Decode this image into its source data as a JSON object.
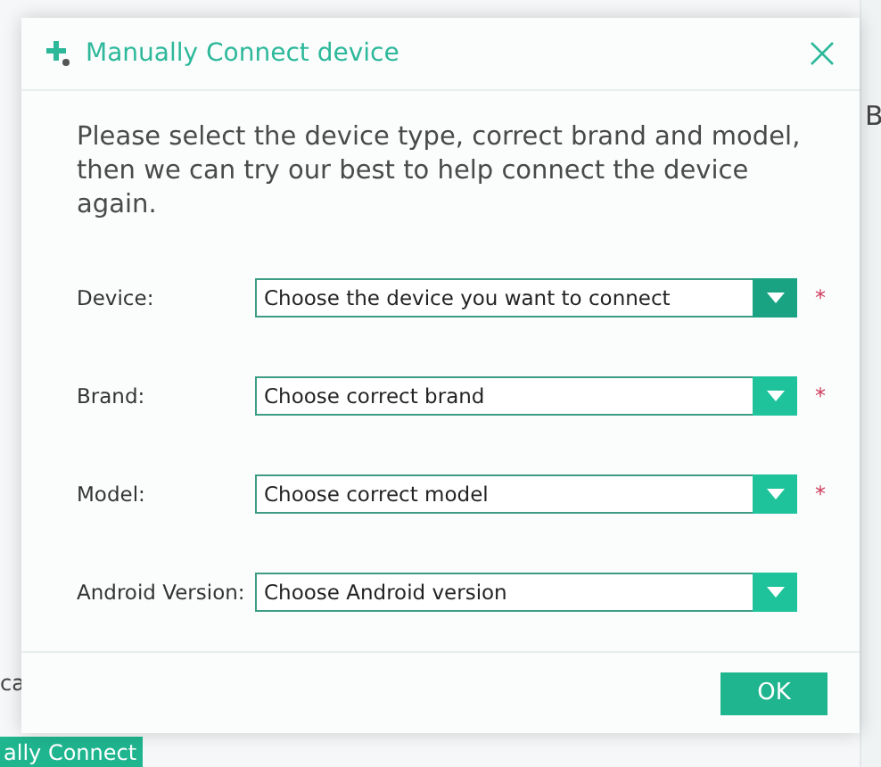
{
  "background": {
    "side_text": "B",
    "left_text": "ca",
    "connect_button": "ally Connect"
  },
  "dialog": {
    "title": "Manually Connect device",
    "intro": "Please select the device type, correct brand and model, then we can try our best to help connect the device again.",
    "fields": [
      {
        "label": "Device:",
        "placeholder": "Choose the device you want to connect",
        "required": true,
        "focused": true
      },
      {
        "label": "Brand:",
        "placeholder": "Choose correct brand",
        "required": true,
        "focused": false
      },
      {
        "label": "Model:",
        "placeholder": "Choose correct model",
        "required": true,
        "focused": false
      },
      {
        "label": "Android Version:",
        "placeholder": "Choose Android version",
        "required": false,
        "focused": false
      }
    ],
    "required_mark": "*",
    "ok_button": "OK"
  }
}
